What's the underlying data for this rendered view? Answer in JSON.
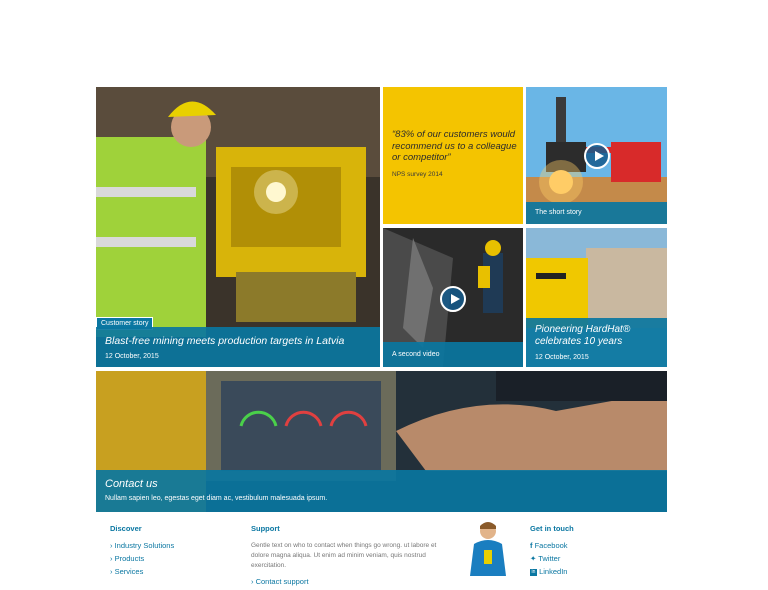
{
  "tiles": {
    "main_story": {
      "badge": "Customer story",
      "title": "Blast-free mining meets production targets in Latvia",
      "date": "12 October, 2015"
    },
    "quote": {
      "text": "“83% of our customers would recommend us to a colleague or competitor”",
      "source": "NPS survey 2014",
      "color": "#f4c400"
    },
    "short_story": {
      "label": "The short story"
    },
    "second_video": {
      "label": "A second video"
    },
    "hardhat": {
      "title": "Pioneering HardHat® celebrates 10 years",
      "date": "12 October, 2015"
    },
    "contact": {
      "title": "Contact us",
      "text": "Nullam sapien leo, egestas eget diam ac, vestibulum malesuada ipsum."
    }
  },
  "footer": {
    "discover": {
      "heading": "Discover",
      "links": [
        "Industry Solutions",
        "Products",
        "Services"
      ]
    },
    "support": {
      "heading": "Support",
      "text": "Gentle text on who to contact when things go wrong. ut labore et dolore magna aliqua. Ut enim ad minim veniam, quis nostrud exercitation.",
      "link": "Contact support"
    },
    "get_in_touch": {
      "heading": "Get in touch",
      "links": [
        "Facebook",
        "Twitter",
        "LinkedIn"
      ]
    }
  },
  "colors": {
    "accent": "#0b77a2",
    "yellow": "#f4c400"
  }
}
